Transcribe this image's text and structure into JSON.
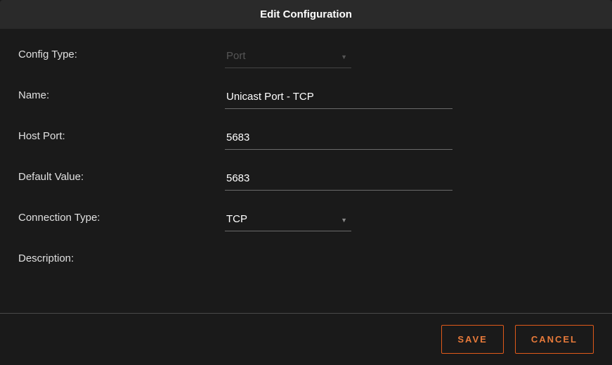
{
  "dialog": {
    "title": "Edit Configuration"
  },
  "form": {
    "config_type": {
      "label": "Config Type:",
      "value": "Port"
    },
    "name": {
      "label": "Name:",
      "value": "Unicast Port - TCP"
    },
    "host_port": {
      "label": "Host Port:",
      "value": "5683"
    },
    "default_value": {
      "label": "Default Value:",
      "value": "5683"
    },
    "connection_type": {
      "label": "Connection Type:",
      "value": "TCP"
    },
    "description": {
      "label": "Description:",
      "value": ""
    }
  },
  "buttons": {
    "save": "SAVE",
    "cancel": "CANCEL"
  }
}
